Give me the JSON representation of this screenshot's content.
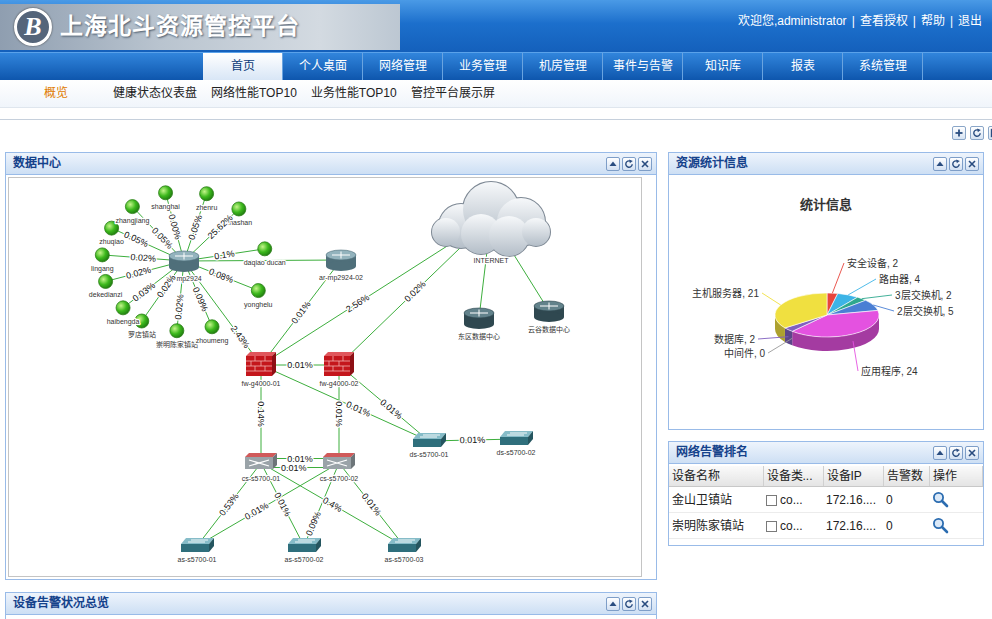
{
  "header": {
    "logo": "B",
    "title": "上海北斗资源管控平台",
    "separator": "|",
    "links": [
      "欢迎您,administrator",
      "查看授权",
      "帮助",
      "退出"
    ]
  },
  "tabs": [
    {
      "label": "首页",
      "selected": true
    },
    {
      "label": "个人桌面",
      "selected": false
    },
    {
      "label": "网络管理",
      "selected": false
    },
    {
      "label": "业务管理",
      "selected": false
    },
    {
      "label": "机房管理",
      "selected": false
    },
    {
      "label": "事件与告警",
      "selected": false
    },
    {
      "label": "知识库",
      "selected": false
    },
    {
      "label": "报表",
      "selected": false
    },
    {
      "label": "系统管理",
      "selected": false
    }
  ],
  "subnav": [
    {
      "label": "概览",
      "selected": true
    },
    {
      "label": "健康状态仪表盘",
      "selected": false
    },
    {
      "label": "网络性能TOP10",
      "selected": false
    },
    {
      "label": "业务性能TOP10",
      "selected": false
    },
    {
      "label": "管控平台展示屏",
      "selected": false
    }
  ],
  "datacenter": {
    "title": "数据中心",
    "nodes": [
      {
        "label": "ne-mp2924",
        "kind": "router"
      },
      {
        "label": "zhangjiang",
        "kind": "site"
      },
      {
        "label": "shanghai",
        "kind": "site"
      },
      {
        "label": "zhenru",
        "kind": "site"
      },
      {
        "label": "shashan",
        "kind": "site"
      },
      {
        "label": "daqiao ducan",
        "kind": "site"
      },
      {
        "label": "zhuqiao",
        "kind": "site"
      },
      {
        "label": "lingang",
        "kind": "site"
      },
      {
        "label": "dekedianzi",
        "kind": "site"
      },
      {
        "label": "haibengda",
        "kind": "site"
      },
      {
        "label": "罗店镇站",
        "kind": "site"
      },
      {
        "label": "崇明陈家镇站",
        "kind": "site"
      },
      {
        "label": "zhoumeng",
        "kind": "site"
      },
      {
        "label": "yonghelu",
        "kind": "site"
      },
      {
        "label": "ar-mp2924-02",
        "kind": "router"
      },
      {
        "label": "INTERNET",
        "kind": "cloud"
      },
      {
        "label": "东区数据中心",
        "kind": "server"
      },
      {
        "label": "云谷数据中心",
        "kind": "server"
      },
      {
        "label": "fw-g4000-01",
        "kind": "firewall"
      },
      {
        "label": "fw-g4000-02",
        "kind": "firewall"
      },
      {
        "label": "ds-s5700-01",
        "kind": "switch"
      },
      {
        "label": "ds-s5700-02",
        "kind": "switch"
      },
      {
        "label": "cs-s5700-01",
        "kind": "core"
      },
      {
        "label": "cs-s5700-02",
        "kind": "core"
      },
      {
        "label": "as-s5700-01",
        "kind": "switch"
      },
      {
        "label": "as-s5700-02",
        "kind": "switch"
      },
      {
        "label": "as-s5700-03",
        "kind": "switch"
      }
    ],
    "edges": [
      {
        "from": 0,
        "to": 1,
        "label": "0.05%"
      },
      {
        "from": 0,
        "to": 2,
        "label": "0.00%"
      },
      {
        "from": 0,
        "to": 3,
        "label": "0.05%"
      },
      {
        "from": 0,
        "to": 4,
        "label": "25.62%"
      },
      {
        "from": 0,
        "to": 5,
        "label": "0.1%"
      },
      {
        "from": 0,
        "to": 6,
        "label": "0.05%"
      },
      {
        "from": 0,
        "to": 7,
        "label": "0.02%"
      },
      {
        "from": 0,
        "to": 8,
        "label": "0.02%"
      },
      {
        "from": 0,
        "to": 9,
        "label": "0.03%"
      },
      {
        "from": 0,
        "to": 10,
        "label": "0.02%"
      },
      {
        "from": 0,
        "to": 11,
        "label": "0.02%"
      },
      {
        "from": 0,
        "to": 12,
        "label": "0.09%"
      },
      {
        "from": 0,
        "to": 13,
        "label": "0.08%"
      },
      {
        "from": 0,
        "to": 14
      },
      {
        "from": 0,
        "to": 18,
        "label": "2.43%"
      },
      {
        "from": 14,
        "to": 18,
        "label": "0.01%"
      },
      {
        "from": 15,
        "to": 18,
        "label": "2.56%"
      },
      {
        "from": 15,
        "to": 19,
        "label": "0.02%"
      },
      {
        "from": 15,
        "to": 16
      },
      {
        "from": 15,
        "to": 17
      },
      {
        "from": 18,
        "to": 19,
        "label": "0.01%"
      },
      {
        "from": 18,
        "to": 22,
        "label": "0.14%"
      },
      {
        "from": 19,
        "to": 23,
        "label": "0.01%"
      },
      {
        "from": 18,
        "to": 20,
        "label": "0.01%"
      },
      {
        "from": 19,
        "to": 20,
        "label": "0.01%"
      },
      {
        "from": 20,
        "to": 21,
        "label": "0.01%"
      },
      {
        "from": 22,
        "to": 23,
        "label": "0.01%"
      },
      {
        "from": 22,
        "to": 23,
        "label": "0.01%"
      },
      {
        "from": 22,
        "to": 24,
        "label": "0.53%"
      },
      {
        "from": 22,
        "to": 25,
        "label": "0.01%"
      },
      {
        "from": 22,
        "to": 26,
        "label": "0.4%"
      },
      {
        "from": 23,
        "to": 24,
        "label": "0.01%"
      },
      {
        "from": 23,
        "to": 25,
        "label": "0.09%"
      },
      {
        "from": 23,
        "to": 26,
        "label": "0.01%"
      }
    ]
  },
  "stats": {
    "title": "资源统计信息",
    "chart_title": "统计信息",
    "slices": [
      {
        "label": "安全设备, 2",
        "value": 2,
        "color": "#e8453c"
      },
      {
        "label": "路由器, 4",
        "value": 4,
        "color": "#3cb4e6"
      },
      {
        "label": "3层交换机, 2",
        "value": 2,
        "color": "#2fa88e"
      },
      {
        "label": "2层交换机, 5",
        "value": 5,
        "color": "#4a7fd4"
      },
      {
        "label": "应用程序, 24",
        "value": 24,
        "color": "#e452e0"
      },
      {
        "label": "中间件, 0",
        "value": 0,
        "color": "#9a9a9a"
      },
      {
        "label": "数据库, 2",
        "value": 2,
        "color": "#8060c0"
      },
      {
        "label": "主机服务器, 21",
        "value": 21,
        "color": "#f0e040"
      }
    ]
  },
  "alarms": {
    "title": "网络告警排名",
    "columns": [
      "设备名称",
      "设备类...",
      "设备IP",
      "告警数",
      "操作"
    ],
    "rows": [
      {
        "cells": [
          "金山卫镇站",
          "co...",
          "172.16....",
          "0"
        ]
      },
      {
        "cells": [
          "崇明陈家镇站",
          "co...",
          "172.16....",
          "0"
        ]
      }
    ]
  },
  "overview": {
    "title": "设备告警状况总览"
  }
}
